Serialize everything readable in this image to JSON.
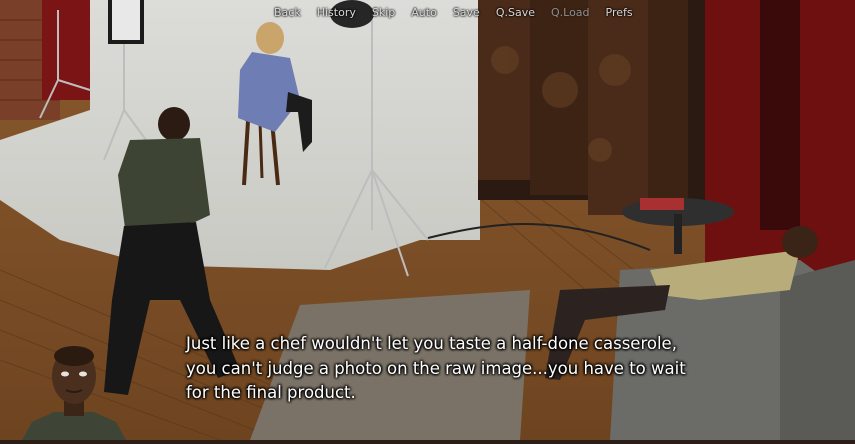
{
  "quick_menu": {
    "items": [
      {
        "label": "Back",
        "enabled": true
      },
      {
        "label": "History",
        "enabled": true
      },
      {
        "label": "Skip",
        "enabled": true
      },
      {
        "label": "Auto",
        "enabled": true
      },
      {
        "label": "Save",
        "enabled": true
      },
      {
        "label": "Q.Save",
        "enabled": true
      },
      {
        "label": "Q.Load",
        "enabled": false
      },
      {
        "label": "Prefs",
        "enabled": true
      }
    ]
  },
  "dialogue": {
    "lines": [
      "Just like a chef wouldn't let you taste a half-done casserole,",
      "you can't judge a photo on the raw image...you have to wait",
      "for the final product."
    ]
  },
  "colors": {
    "dialogue_text": "#ffffff",
    "menu_text": "#d8d8d8",
    "menu_disabled": "#8e8e8e"
  }
}
